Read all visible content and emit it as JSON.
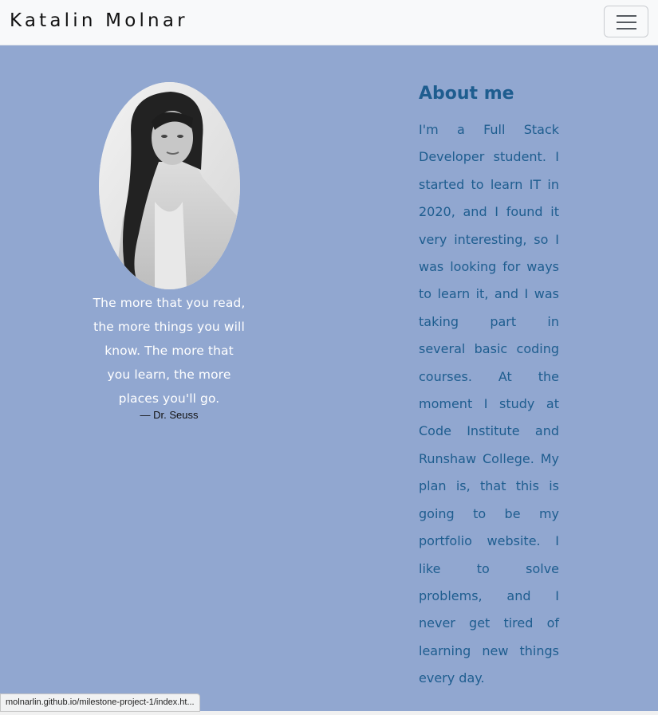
{
  "navbar": {
    "brand": "Katalin Molnar",
    "toggler_icon": "hamburger-menu-icon"
  },
  "profile": {
    "photo_description": "black-and-white portrait photo",
    "quote_lines": [
      "The more that you read,",
      "the more things you will",
      "know. The more that",
      "you learn, the more",
      "places you'll go."
    ],
    "author": "— Dr. Seuss"
  },
  "about": {
    "heading": "About me",
    "lines": [
      "I'm a Full Stack",
      "Developer student. I",
      "started to learn IT in",
      "2020, and I found it",
      "very interesting, so I",
      "was looking for ways",
      "to learn it, and I was",
      "taking part in",
      "several basic coding",
      "courses. At the",
      "moment I study at",
      "Code Institute and",
      "Runshaw College. My",
      "plan is, that this is",
      "going to be my",
      "portfolio website. I",
      "like to solve",
      "problems, and I",
      "never get tired of",
      "learning new things",
      "every day."
    ]
  },
  "status_bar": {
    "url": "molnarlin.github.io/milestone-project-1/index.ht..."
  },
  "colors": {
    "navbar_bg": "#f8f9fa",
    "page_bg": "#91a7d0",
    "about_text": "#1e5d8f",
    "quote_text": "#ffffff"
  }
}
